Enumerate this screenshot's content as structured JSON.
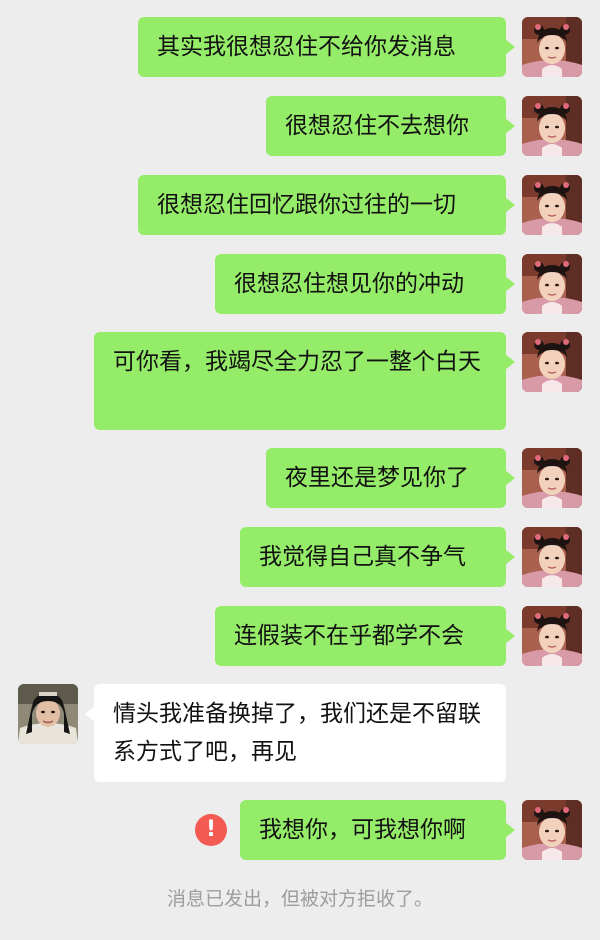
{
  "messages": [
    {
      "side": "right",
      "text": "其实我很想忍住不给你发消息"
    },
    {
      "side": "right",
      "text": "很想忍住不去想你"
    },
    {
      "side": "right",
      "text": "很想忍住回忆跟你过往的一切"
    },
    {
      "side": "right",
      "text": "很想忍住想见你的冲动"
    },
    {
      "side": "right",
      "text": "可你看，我竭尽全力忍了一整个白天"
    },
    {
      "side": "right",
      "text": "夜里还是梦见你了"
    },
    {
      "side": "right",
      "text": "我觉得自己真不争气"
    },
    {
      "side": "right",
      "text": "连假装不在乎都学不会"
    },
    {
      "side": "left",
      "text": "情头我准备换掉了，我们还是不留联系方式了吧，再见"
    },
    {
      "side": "right",
      "text": "我想你，可我想你啊",
      "status": "failed"
    }
  ],
  "error_icon": "!",
  "system_note": "消息已发出，但被对方拒收了。",
  "colors": {
    "background": "#ededed",
    "outgoing_bubble": "#95ec69",
    "incoming_bubble": "#ffffff",
    "error_badge": "#f25a52",
    "system_text": "#9d9d9d"
  }
}
